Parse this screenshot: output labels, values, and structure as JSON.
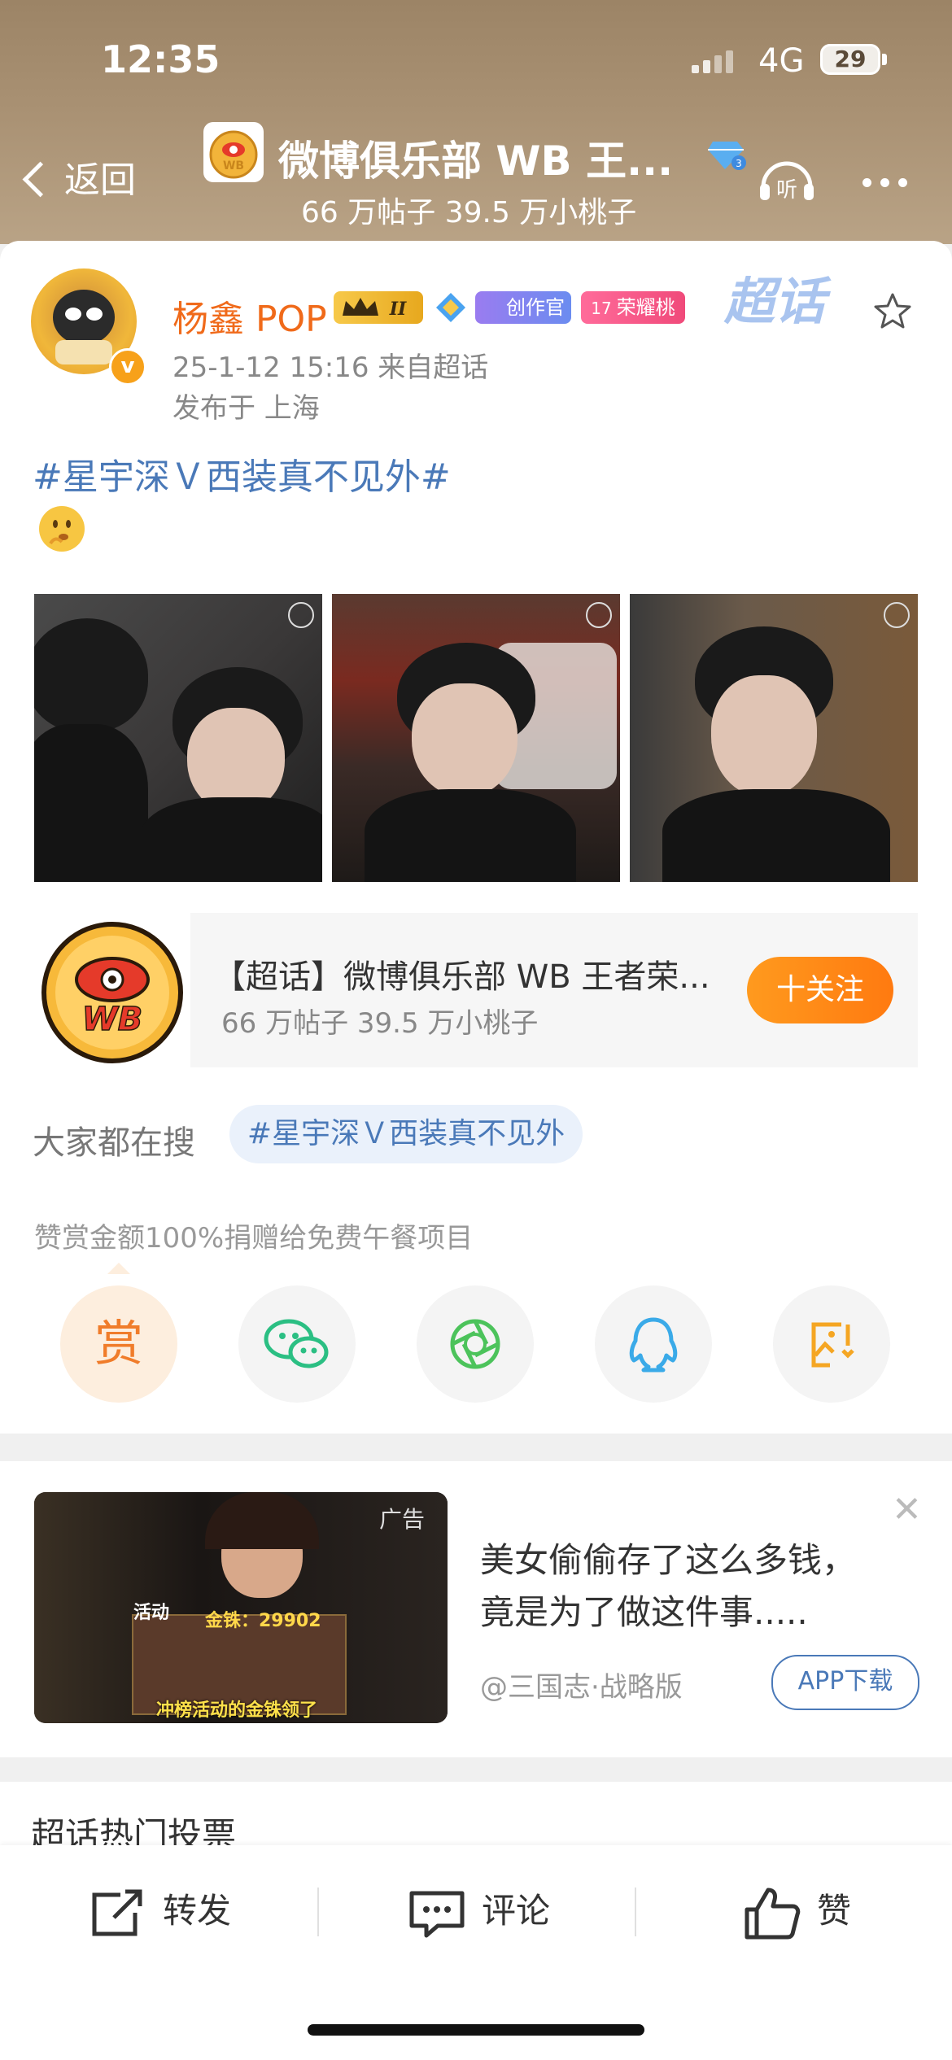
{
  "status_bar": {
    "time": "12:35",
    "network": "4G",
    "battery": "29"
  },
  "header": {
    "back_label": "返回",
    "title": "微博俱乐部 WB 王...",
    "subtitle": "66 万帖子  39.5 万小桃子",
    "listen_label": "听"
  },
  "post": {
    "username": "杨鑫 POP",
    "badges": {
      "creator": "创作官",
      "level": "17",
      "peach": "荣耀桃"
    },
    "time_source": "25-1-12 15:16   来自超话",
    "location": "发布于 上海",
    "watermark": "超话",
    "topic": "#星宇深Ｖ西装真不见外#",
    "supertopic_card": {
      "title": "【超话】微博俱乐部 WB 王者荣...",
      "subtitle": "66 万帖子  39.5 万小桃子",
      "follow_label": "十关注"
    },
    "search": {
      "label": "大家都在搜",
      "chip": "#星宇深Ｖ西装真不见外"
    },
    "donate_text": "赞赏金额100%捐赠给免费午餐项目",
    "reward_label": "赏"
  },
  "ad": {
    "tag": "广告",
    "title": "美女偷偷存了这么多钱，竟是为了做这件事.....",
    "source": "@三国志·战略版",
    "button": "APP下载",
    "image_text": {
      "coins": "金铢：29902",
      "caption": "冲榜活动的金铢领了",
      "corner": "活动"
    }
  },
  "section": {
    "vote_title": "超话热门投票"
  },
  "bottom_bar": {
    "repost": "转发",
    "comment": "评论",
    "like": "赞"
  }
}
